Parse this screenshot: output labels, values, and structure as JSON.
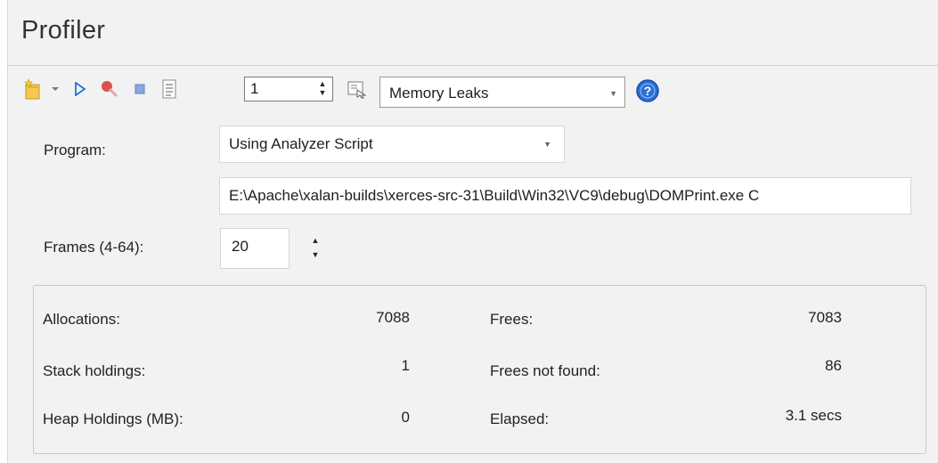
{
  "title": "Profiler",
  "toolbar": {
    "icons": [
      "new-icon",
      "dropdown-arrow-icon",
      "run-icon",
      "record-icon",
      "stop-icon",
      "report-icon",
      "options-icon",
      "help-icon"
    ],
    "spin_value": "1",
    "mode_value": "Memory Leaks"
  },
  "form": {
    "program_label": "Program:",
    "program_value": "Using Analyzer Script",
    "command_value": "E:\\Apache\\xalan-builds\\xerces-src-31\\Build\\Win32\\VC9\\debug\\DOMPrint.exe C",
    "frames_label": "Frames (4-64):",
    "frames_value": "20"
  },
  "stats": {
    "allocations_label": "Allocations:",
    "allocations_value": "7088",
    "stack_label": "Stack holdings:",
    "stack_value": "1",
    "heap_label": "Heap Holdings (MB):",
    "heap_value": "0",
    "frees_label": "Frees:",
    "frees_value": "7083",
    "frees_nf_label": "Frees not found:",
    "frees_nf_value": "86",
    "elapsed_label": "Elapsed:",
    "elapsed_value": "3.1 secs"
  },
  "colors": {
    "panel_bg": "#f2f2f2",
    "accent_blue": "#2b6fd6",
    "record_red": "#d9534f"
  }
}
